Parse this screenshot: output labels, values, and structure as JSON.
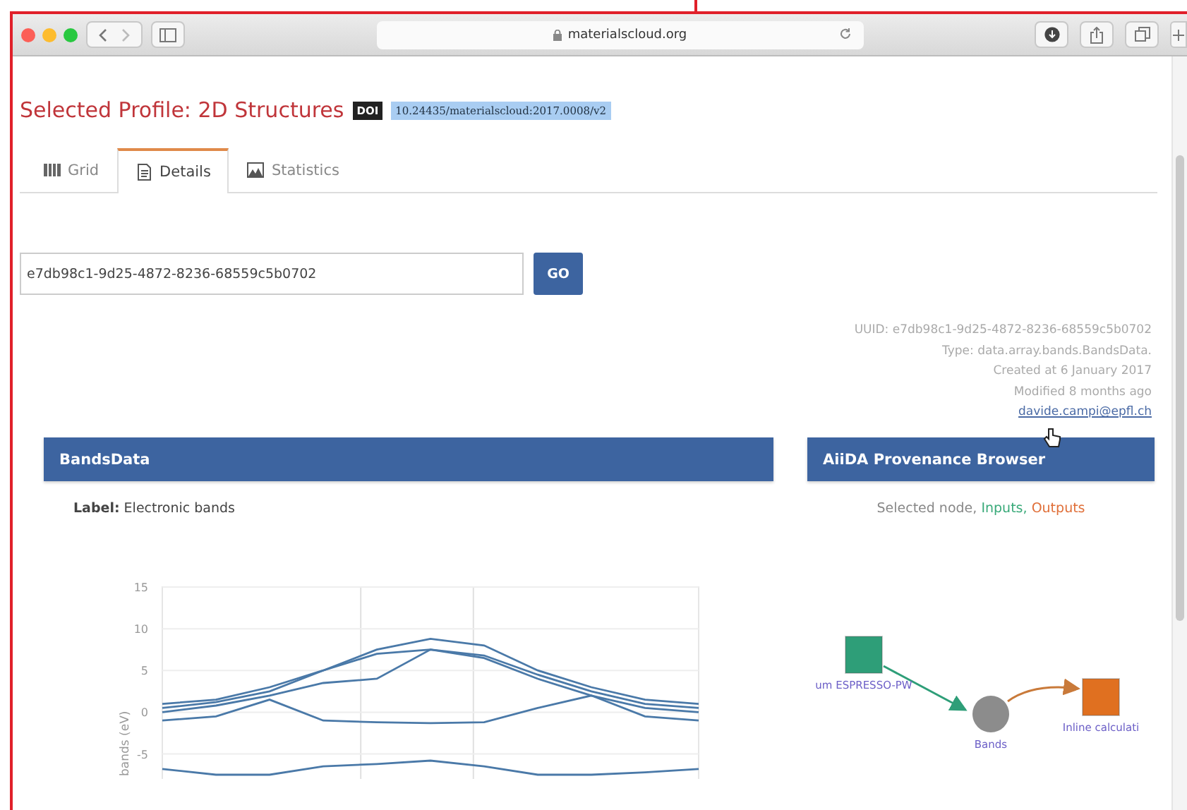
{
  "browser": {
    "address": "materialscloud.org"
  },
  "header": {
    "title": "Selected Profile: 2D Structures",
    "doi_badge": "DOI",
    "doi": "10.24435/materialscloud:2017.0008/v2"
  },
  "tabs": [
    {
      "label": "Grid",
      "selected": false,
      "kind": "grid"
    },
    {
      "label": "Details",
      "selected": true,
      "kind": "details"
    },
    {
      "label": "Statistics",
      "selected": false,
      "kind": "statistics"
    }
  ],
  "search": {
    "value": "e7db98c1-9d25-4872-8236-68559c5b0702",
    "button": "GO"
  },
  "meta": {
    "lines": [
      "UUID: e7db98c1-9d25-4872-8236-68559c5b0702",
      "Type: data.array.bands.BandsData.",
      "Created at 6 January 2017",
      "Modified 8 months ago"
    ],
    "email": "davide.campi@epfl.ch"
  },
  "bands_panel": {
    "title": "BandsData",
    "label_key": "Label:",
    "label_value": "Electronic bands",
    "chart_data": {
      "type": "line",
      "ylabel": "bands (eV)",
      "ylim": [
        -8,
        15
      ],
      "yticks": [
        -5,
        0,
        5,
        10,
        15
      ],
      "grid": true,
      "series": [
        {
          "color": "#4a79a8",
          "values": [
            1,
            1.5,
            3,
            5,
            7.5,
            8.8,
            8,
            5,
            3,
            1.5,
            1
          ]
        },
        {
          "color": "#4a79a8",
          "values": [
            0.5,
            1.2,
            2.5,
            5,
            7,
            7.5,
            6.8,
            4.5,
            2.5,
            1,
            0.5
          ]
        },
        {
          "color": "#4a79a8",
          "values": [
            0,
            0.8,
            2,
            3.5,
            4,
            7.5,
            6.5,
            4,
            2,
            0.5,
            0
          ]
        },
        {
          "color": "#4a79a8",
          "values": [
            -1,
            -0.5,
            1.5,
            -1,
            -1.2,
            -1.3,
            -1.2,
            0.5,
            2,
            -0.5,
            -1
          ]
        },
        {
          "color": "#4a79a8",
          "values": [
            -6.8,
            -7.5,
            -7.5,
            -6.5,
            -6.2,
            -5.8,
            -6.5,
            -7.5,
            -7.5,
            -7.2,
            -6.8
          ]
        }
      ]
    }
  },
  "provenance_panel": {
    "title": "AiiDA Provenance Browser",
    "legend": [
      {
        "text": "Selected node,",
        "color": "#888888"
      },
      {
        "text": "Inputs,",
        "color": "#3aaa7a"
      },
      {
        "text": "Outputs",
        "color": "#e0703a"
      }
    ],
    "nodes": [
      {
        "label": "um ESPRESSO-PW",
        "kind": "square",
        "color": "#2e9e78"
      },
      {
        "label": "Bands",
        "kind": "circle",
        "color": "#8c8c8c"
      },
      {
        "label": "Inline calculati",
        "kind": "square",
        "color": "#e07020"
      }
    ]
  }
}
